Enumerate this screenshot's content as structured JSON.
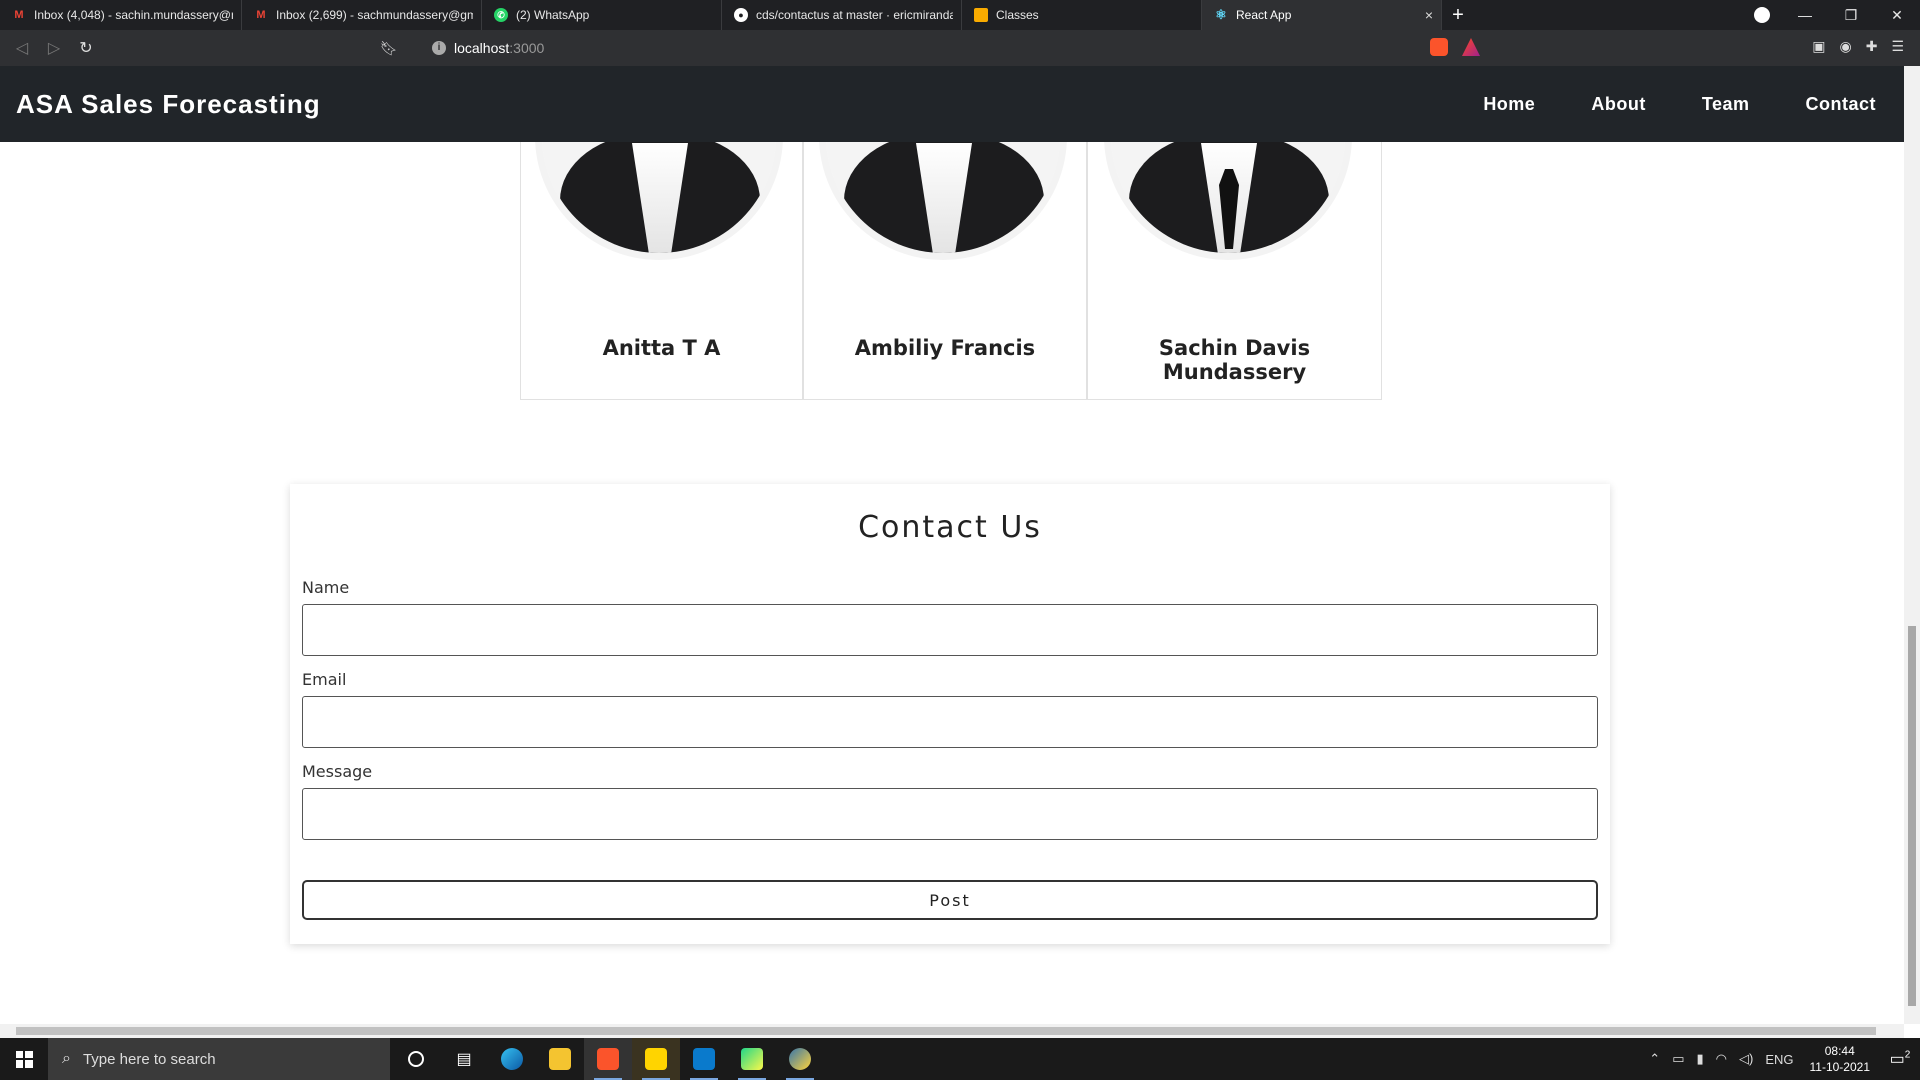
{
  "browser": {
    "tabs": [
      {
        "title": "Inbox (4,048) - sachin.mundassery@m",
        "icon": "gmail-icon",
        "color": "#ea4335",
        "active": false
      },
      {
        "title": "Inbox (2,699) - sachmundassery@gma",
        "icon": "gmail-icon",
        "color": "#ea4335",
        "active": false
      },
      {
        "title": "(2) WhatsApp",
        "icon": "whatsapp-icon",
        "color": "#25d366",
        "active": false
      },
      {
        "title": "cds/contactus at master · ericmiranda7",
        "icon": "github-icon",
        "color": "#ffffff",
        "active": false
      },
      {
        "title": "Classes",
        "icon": "classroom-icon",
        "color": "#f9ab00",
        "active": false
      },
      {
        "title": "React App",
        "icon": "react-icon",
        "color": "#61dafb",
        "active": true
      }
    ],
    "new_tab": "+",
    "close_tab": "×",
    "url_host": "localhost",
    "url_port": ":3000"
  },
  "site": {
    "brand": "ASA Sales Forecasting",
    "nav": [
      "Home",
      "About",
      "Team",
      "Contact"
    ]
  },
  "team": [
    {
      "name": "Anitta T A"
    },
    {
      "name": "Ambiliy Francis"
    },
    {
      "name": "Sachin Davis Mundassery"
    }
  ],
  "contact": {
    "title": "Contact Us",
    "name_label": "Name",
    "email_label": "Email",
    "message_label": "Message",
    "name_value": "",
    "email_value": "",
    "message_value": "",
    "post_label": "Post"
  },
  "taskbar": {
    "search_placeholder": "Type here to search",
    "lang": "ENG",
    "time": "08:44",
    "date": "11-10-2021",
    "notification_count": "2"
  }
}
